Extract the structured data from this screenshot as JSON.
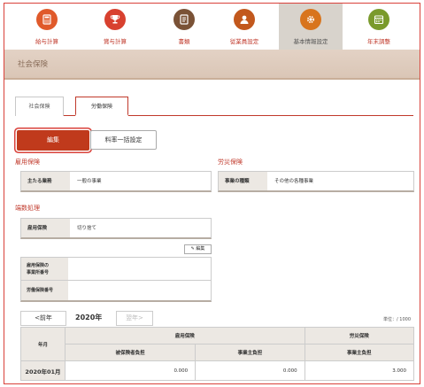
{
  "nav": {
    "items": [
      {
        "label": "給与計算",
        "icon": "calculator-icon",
        "color": "#e05a2b"
      },
      {
        "label": "賞与計算",
        "icon": "trophy-icon",
        "color": "#d8412f"
      },
      {
        "label": "書類",
        "icon": "document-icon",
        "color": "#7a5236"
      },
      {
        "label": "従業員設定",
        "icon": "person-icon",
        "color": "#c2581d"
      },
      {
        "label": "基本情報設定",
        "icon": "gear-icon",
        "color": "#d8741d"
      },
      {
        "label": "年末調整",
        "icon": "calendar-icon",
        "color": "#7a9a2c"
      }
    ]
  },
  "page_title": "社会保険",
  "tabs": [
    {
      "label": "社会保険"
    },
    {
      "label": "労働保険"
    }
  ],
  "buttons": {
    "edit": "編集",
    "bulk_rate": "料率一括設定",
    "mini_edit": "編集"
  },
  "employment": {
    "title": "雇用保険",
    "key": "主たる業務",
    "value": "一般の事業"
  },
  "accident": {
    "title": "労災保険",
    "key": "事業の種類",
    "value": "その他の各種事業"
  },
  "rounding": {
    "title": "端数処理",
    "key": "雇用保険",
    "value": "切り捨て"
  },
  "numbers": {
    "employment_no_label": "雇用保険の\n事業所番号",
    "labor_no_label": "労働保険番号"
  },
  "year_nav": {
    "prev": "<前年",
    "year": "2020年",
    "next": "翌年>",
    "unit": "単位：/ 1000"
  },
  "table": {
    "month_header": "年月",
    "group_employment": "雇用保険",
    "group_accident": "労災保険",
    "col_insured": "被保険者負担",
    "col_employer": "事業主負担",
    "col_employer2": "事業主負担",
    "rows": [
      {
        "month": "2020年01月",
        "insured": "0.000",
        "employer": "0.000",
        "accident_employer": "3.000"
      }
    ]
  },
  "colors": {
    "accent": "#c0392b",
    "title_band": "#dac6b6"
  }
}
